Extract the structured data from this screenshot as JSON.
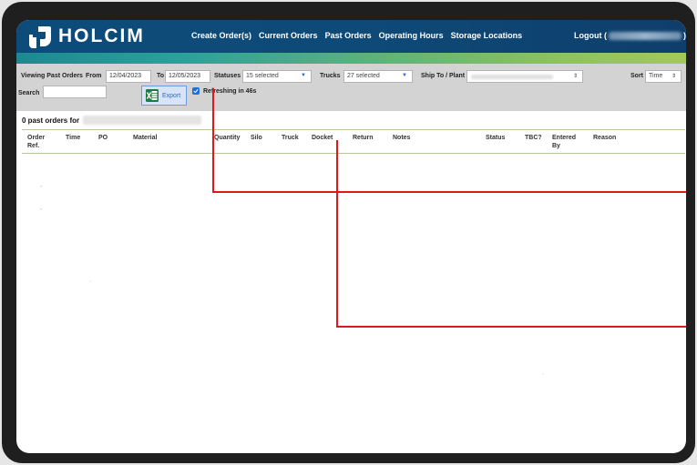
{
  "brand": {
    "name": "HOLCIM"
  },
  "nav": {
    "items": [
      "Create Order(s)",
      "Current Orders",
      "Past Orders",
      "Operating Hours",
      "Storage Locations"
    ],
    "logout_prefix": "Logout (",
    "logout_suffix": ")"
  },
  "filters": {
    "viewing_label": "Viewing Past Orders",
    "from_label": "From",
    "from_value": "12/04/2023",
    "to_label": "To",
    "to_value": "12/05/2023",
    "statuses_label": "Statuses",
    "statuses_value": "15 selected",
    "trucks_label": "Trucks",
    "trucks_value": "27 selected",
    "ship_label": "Ship To / Plant",
    "sort_label": "Sort",
    "sort_value": "Time",
    "search_label": "Search",
    "search_value": "",
    "export_label": "Export",
    "refresh_label": "Refreshing in 46s",
    "refresh_checked": true
  },
  "summary": {
    "text": "0 past orders for"
  },
  "table": {
    "columns": [
      "Order Ref.",
      "Time",
      "PO",
      "Material",
      "Quantity",
      "Silo",
      "Truck",
      "Docket",
      "Return",
      "Notes",
      "Status",
      "TBC?",
      "Entered By",
      "Reason"
    ],
    "rows": []
  },
  "colors": {
    "topbar": "#0d4c7a",
    "accent_blue": "#1e6fd9",
    "annotation_red": "#e01818",
    "filter_bg": "#d3d3d3"
  },
  "icons": {
    "logo": "holcim-logo-icon",
    "excel": "excel-icon",
    "caret": "caret-icon",
    "checkbox": "checkbox-checked-icon"
  }
}
